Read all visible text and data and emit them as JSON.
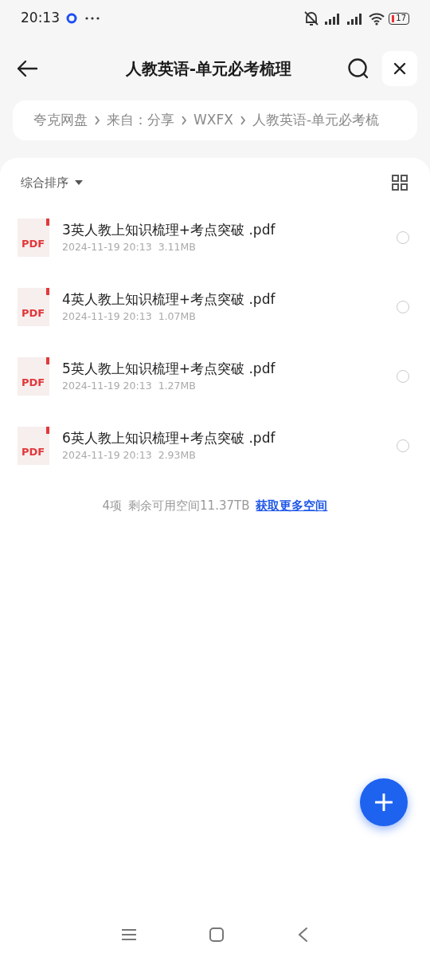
{
  "status_bar": {
    "time": "20:13",
    "battery": "17"
  },
  "header": {
    "title": "人教英语-单元必考梳理"
  },
  "breadcrumb": [
    "夸克网盘",
    "来自：分享",
    "WXFX",
    "人教英语-单元必考梳"
  ],
  "sort": {
    "label": "综合排序"
  },
  "files": [
    {
      "name": "3英人教上知识梳理+考点突破 .pdf",
      "date": "2024-11-19 20:13",
      "size": "3.11MB",
      "icon_label": "PDF",
      "selected": false
    },
    {
      "name": "4英人教上知识梳理+考点突破 .pdf",
      "date": "2024-11-19 20:13",
      "size": "1.07MB",
      "icon_label": "PDF",
      "selected": false
    },
    {
      "name": "5英人教上知识梳理+考点突破 .pdf",
      "date": "2024-11-19 20:13",
      "size": "1.27MB",
      "icon_label": "PDF",
      "selected": false
    },
    {
      "name": "6英人教上知识梳理+考点突破 .pdf",
      "date": "2024-11-19 20:13",
      "size": "2.93MB",
      "icon_label": "PDF",
      "selected": false
    }
  ],
  "summary": {
    "count": "4项",
    "space": "剩余可用空间11.37TB",
    "link": "获取更多空间"
  }
}
